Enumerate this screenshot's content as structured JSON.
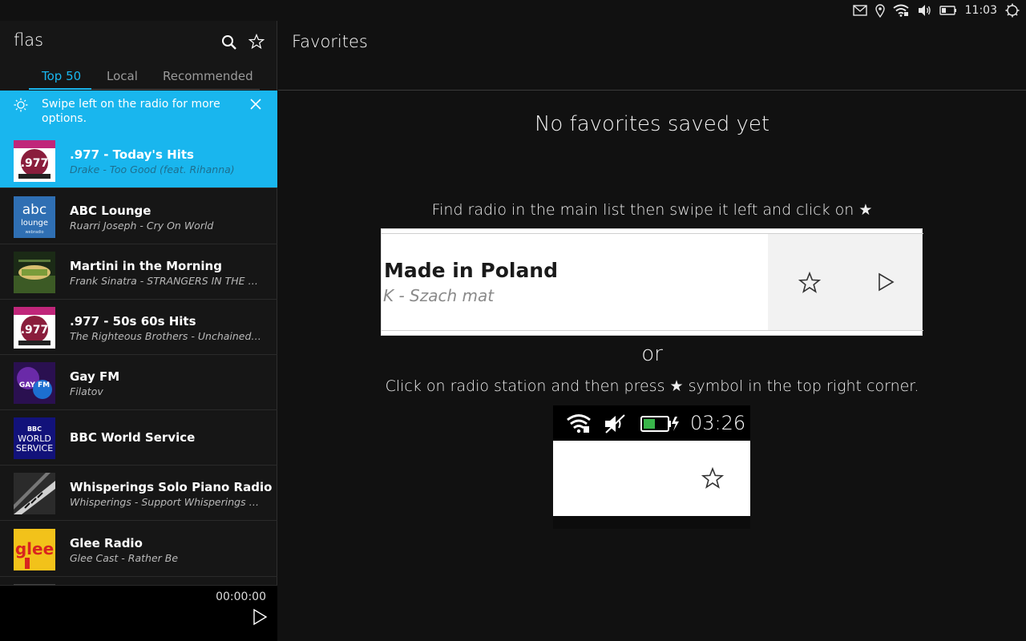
{
  "status_bar": {
    "time": "11:03",
    "icons": [
      "mail-icon",
      "location-icon",
      "wifi-icon",
      "volume-icon",
      "battery-icon",
      "power-icon"
    ]
  },
  "sidebar": {
    "title": "flas",
    "tabs": [
      {
        "label": "Top 50",
        "active": true
      },
      {
        "label": "Local",
        "active": false
      },
      {
        "label": "Recommended",
        "active": false
      }
    ],
    "hint": "Swipe left on the radio for more options.",
    "stations": [
      {
        "name": ".977 - Today's Hits",
        "subtitle": "Drake - Too Good (feat. Rihanna)",
        "selected": true,
        "logo": "977"
      },
      {
        "name": "ABC Lounge",
        "subtitle": "Ruarri Joseph - Cry On World",
        "selected": false,
        "logo": "abc"
      },
      {
        "name": "Martini in the Morning",
        "subtitle": "Frank Sinatra - STRANGERS IN THE NIGHT",
        "selected": false,
        "logo": "martini"
      },
      {
        "name": ".977 - 50s 60s Hits",
        "subtitle": "The Righteous Brothers - Unchained Melody",
        "selected": false,
        "logo": "977"
      },
      {
        "name": "Gay FM",
        "subtitle": "Filatov",
        "selected": false,
        "logo": "gayfm"
      },
      {
        "name": "BBC World Service",
        "subtitle": "",
        "selected": false,
        "logo": "bbc"
      },
      {
        "name": "Whisperings Solo Piano Radio",
        "subtitle": "Whisperings - Support Whisperings at SoundCloud",
        "selected": false,
        "logo": "piano"
      },
      {
        "name": "Glee Radio",
        "subtitle": "Glee Cast - Rather Be",
        "selected": false,
        "logo": "glee"
      }
    ],
    "logo_text": {
      "977": ".977",
      "abc_top": "abc",
      "abc_mid": "lounge",
      "abc_bot": "webradio",
      "gayfm": "GAY FM",
      "bbc_top": "BBC",
      "bbc_mid": "WORLD",
      "bbc_bot": "SERVICE",
      "glee": "glee"
    },
    "player": {
      "time": "00:00:00"
    }
  },
  "main": {
    "title": "Favorites",
    "empty_title": "No favorites saved yet",
    "instruction_1": "Find radio in the main list then swipe it left and click on ★",
    "example": {
      "station_name": "Made in Poland",
      "station_subtitle": "K - Szach mat"
    },
    "or_text": "or",
    "instruction_2": "Click on radio station and then press ★ symbol in the top right corner.",
    "phone_time": "03:26"
  },
  "colors": {
    "accent": "#19b6ee",
    "background": "#111111",
    "sidebar": "#161616"
  }
}
